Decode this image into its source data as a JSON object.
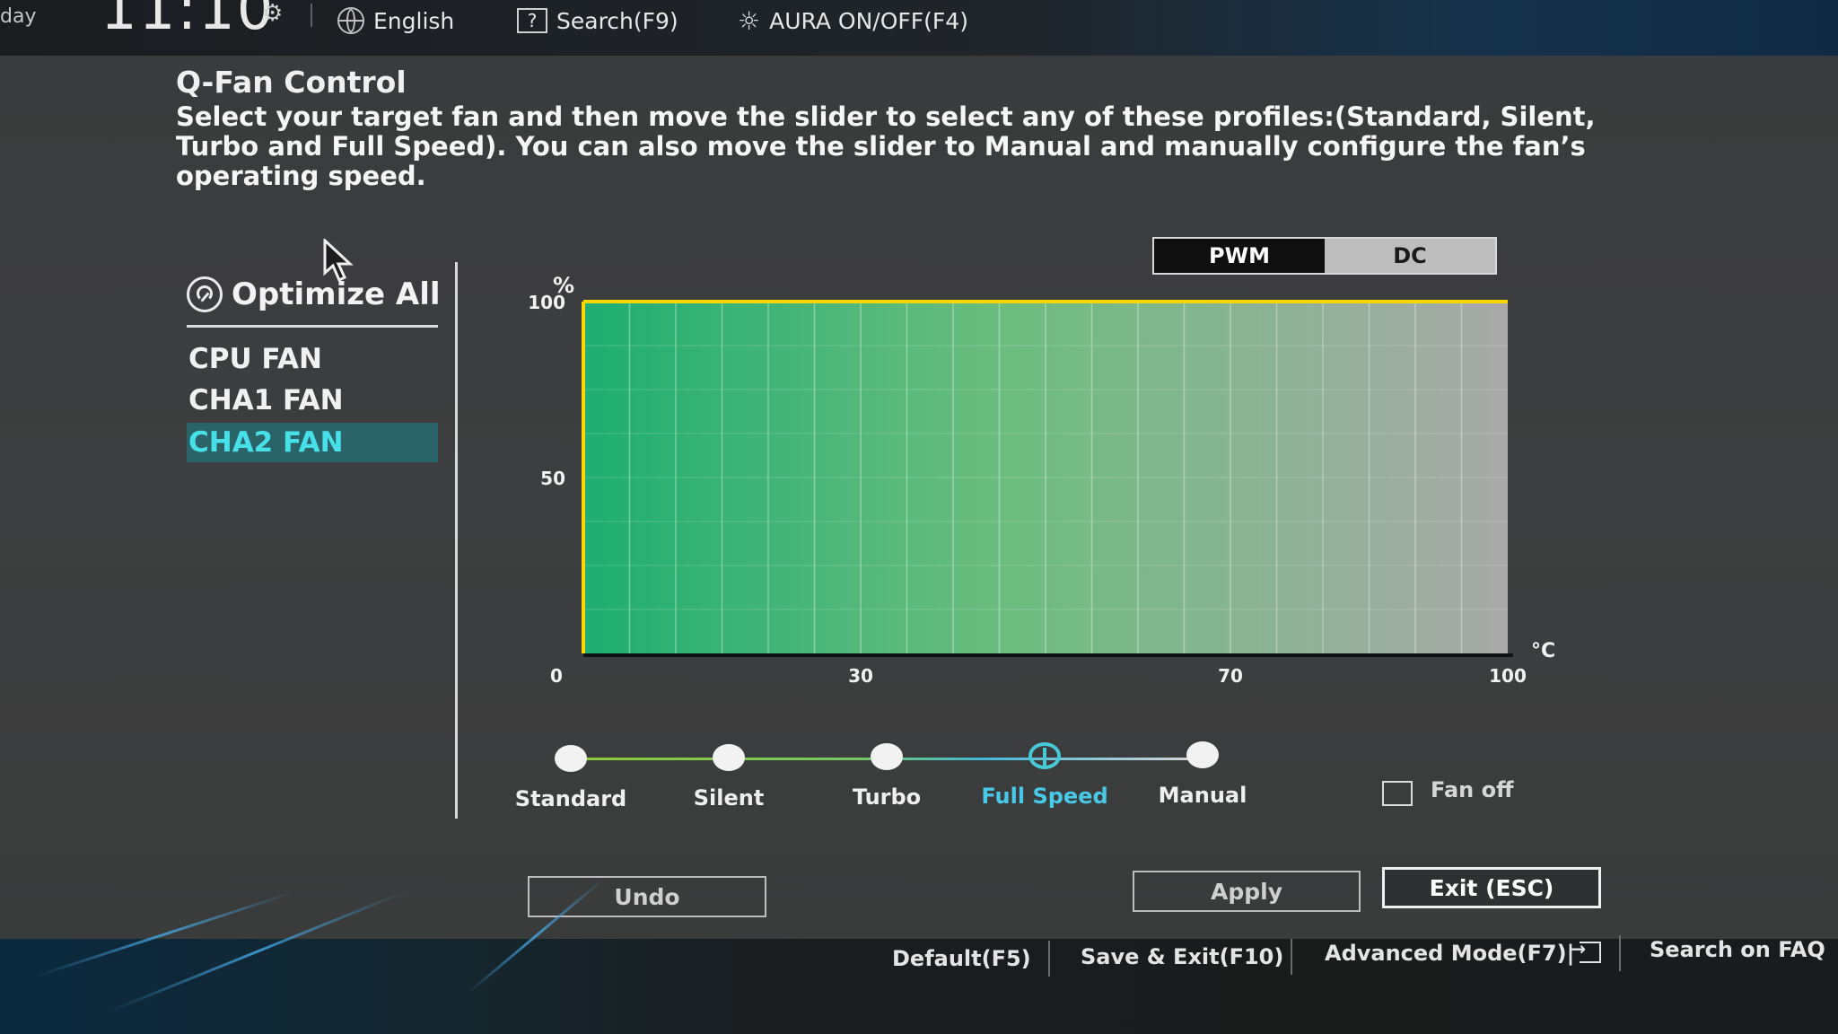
{
  "header": {
    "date": "day",
    "clock": "11:10",
    "language": "English",
    "search": "Search(F9)",
    "aura": "AURA ON/OFF(F4)"
  },
  "title": "Q-Fan Control",
  "description": "Select your target fan and then move the slider to select any of these profiles:(Standard, Silent, Turbo and Full Speed). You can also move the slider to Manual and manually configure the fan’s operating speed.",
  "sidebar": {
    "optimize_label": "Optimize All",
    "fans": [
      {
        "label": "CPU FAN",
        "selected": false
      },
      {
        "label": "CHA1 FAN",
        "selected": false
      },
      {
        "label": "CHA2 FAN",
        "selected": true
      }
    ]
  },
  "mode": {
    "options": [
      "PWM",
      "DC"
    ],
    "selected": "PWM"
  },
  "chart_data": {
    "type": "area",
    "ylabel": "%",
    "xlabel": "°C",
    "x": [
      0,
      100
    ],
    "y": [
      100,
      100
    ],
    "xlim": [
      0,
      100
    ],
    "ylim": [
      0,
      100
    ],
    "xticks": [
      0,
      30,
      70,
      100
    ],
    "yticks": [
      50,
      100
    ],
    "grid": true,
    "colors": {
      "fill_start": "#1fae72",
      "fill_end": "#a9a9a9",
      "curve": "#ffd600"
    }
  },
  "profiles": {
    "items": [
      "Standard",
      "Silent",
      "Turbo",
      "Full Speed",
      "Manual"
    ],
    "selected": "Full Speed"
  },
  "fan_off_label": "Fan off",
  "buttons": {
    "undo": "Undo",
    "apply": "Apply",
    "exit": "Exit (ESC)"
  },
  "footer": {
    "default": "Default(F5)",
    "save_exit": "Save & Exit(F10)",
    "advanced": "Advanced Mode(F7)|",
    "faq": "Search on FAQ"
  },
  "colors": {
    "accent": "#48c9e8",
    "selected_bg": "#2a6468"
  }
}
